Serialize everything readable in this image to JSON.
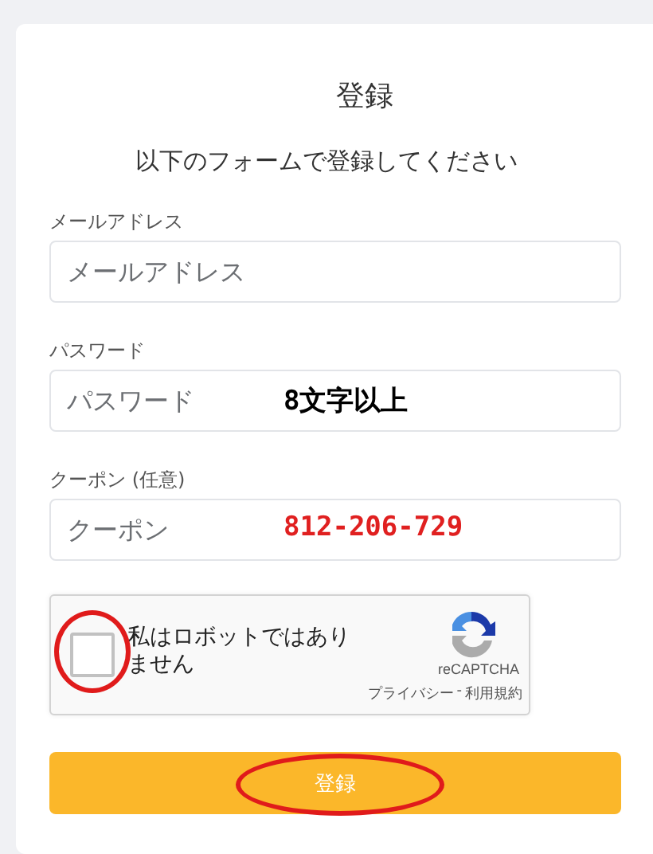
{
  "title": "登録",
  "subtitle": "以下のフォームで登録してください",
  "fields": [
    {
      "label": "メールアドレス",
      "placeholder": "メールアドレス"
    },
    {
      "label": "パスワード",
      "placeholder": "パスワード",
      "note": {
        "text": "8文字以上",
        "color": "#000000"
      }
    },
    {
      "label": "クーポン (任意)",
      "placeholder": "クーポン",
      "note": {
        "text": "812-206-729",
        "color": "#e02020"
      }
    }
  ],
  "captcha": {
    "label": "私はロボットではありません",
    "checked": false,
    "circled": true,
    "brand": "reCAPTCHA",
    "links": [
      "プライバシー",
      "利用規約"
    ],
    "separator": "-"
  },
  "submit": {
    "label": "登録",
    "circled": true
  }
}
